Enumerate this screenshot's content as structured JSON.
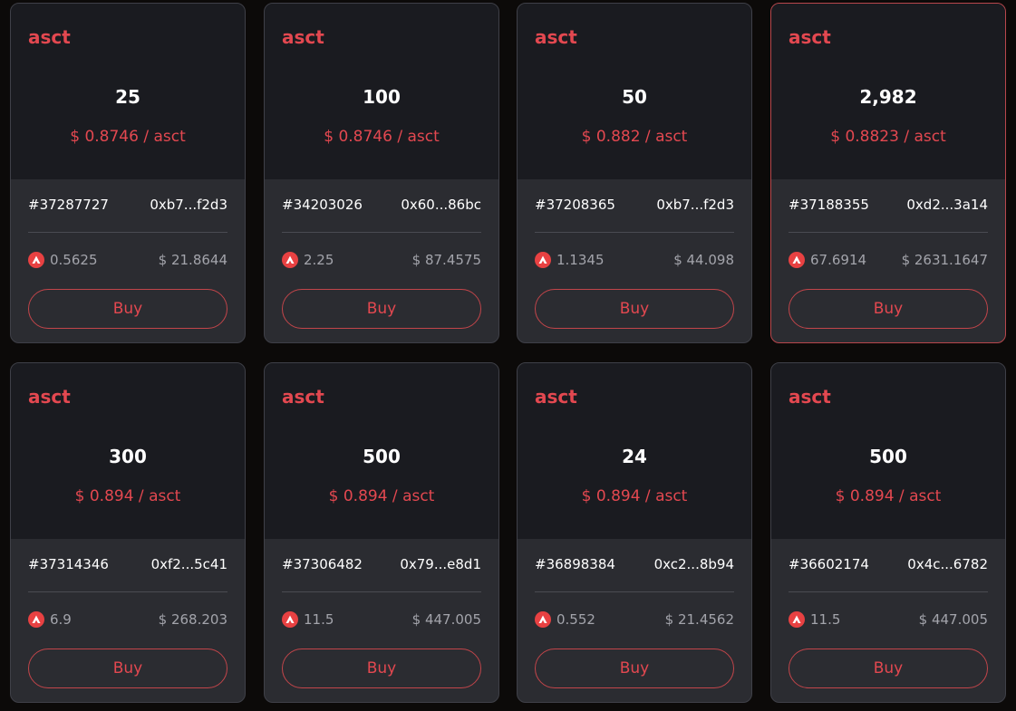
{
  "buy_label": "Buy",
  "colors": {
    "accent": "#e34850",
    "avax": "#e84142",
    "card_top": "#1a1b20",
    "card_bottom": "#2b2c31"
  },
  "listings": [
    {
      "ticker": "asct",
      "amount": "25",
      "unit_price": "$ 0.8746 / asct",
      "id": "#37287727",
      "address": "0xb7...f2d3",
      "avax_price": "0.5625",
      "usd_price": "$ 21.8644",
      "highlighted": false
    },
    {
      "ticker": "asct",
      "amount": "100",
      "unit_price": "$ 0.8746 / asct",
      "id": "#34203026",
      "address": "0x60...86bc",
      "avax_price": "2.25",
      "usd_price": "$ 87.4575",
      "highlighted": false
    },
    {
      "ticker": "asct",
      "amount": "50",
      "unit_price": "$ 0.882 / asct",
      "id": "#37208365",
      "address": "0xb7...f2d3",
      "avax_price": "1.1345",
      "usd_price": "$ 44.098",
      "highlighted": false
    },
    {
      "ticker": "asct",
      "amount": "2,982",
      "unit_price": "$ 0.8823 / asct",
      "id": "#37188355",
      "address": "0xd2...3a14",
      "avax_price": "67.6914",
      "usd_price": "$ 2631.1647",
      "highlighted": true
    },
    {
      "ticker": "asct",
      "amount": "300",
      "unit_price": "$ 0.894 / asct",
      "id": "#37314346",
      "address": "0xf2...5c41",
      "avax_price": "6.9",
      "usd_price": "$ 268.203",
      "highlighted": false
    },
    {
      "ticker": "asct",
      "amount": "500",
      "unit_price": "$ 0.894 / asct",
      "id": "#37306482",
      "address": "0x79...e8d1",
      "avax_price": "11.5",
      "usd_price": "$ 447.005",
      "highlighted": false
    },
    {
      "ticker": "asct",
      "amount": "24",
      "unit_price": "$ 0.894 / asct",
      "id": "#36898384",
      "address": "0xc2...8b94",
      "avax_price": "0.552",
      "usd_price": "$ 21.4562",
      "highlighted": false
    },
    {
      "ticker": "asct",
      "amount": "500",
      "unit_price": "$ 0.894 / asct",
      "id": "#36602174",
      "address": "0x4c...6782",
      "avax_price": "11.5",
      "usd_price": "$ 447.005",
      "highlighted": false
    }
  ]
}
